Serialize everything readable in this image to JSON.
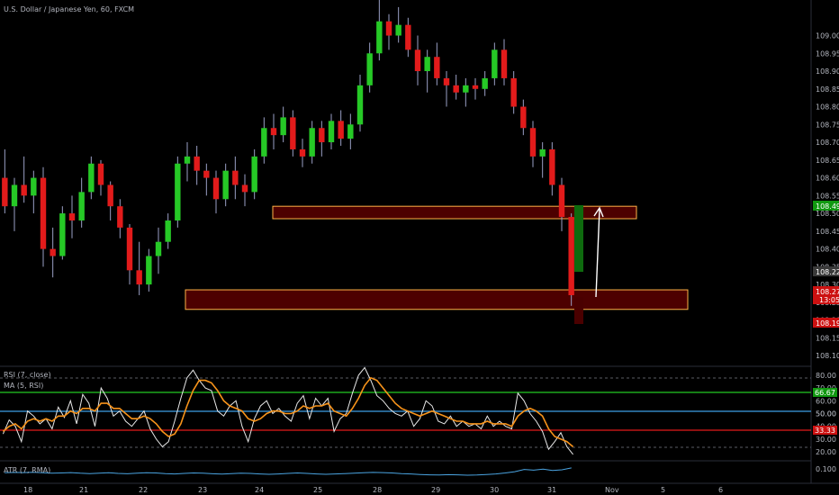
{
  "header": {
    "symbol_title": "U.S. Dollar / Japanese Yen, 60, FXCM"
  },
  "rsi_panel": {
    "title": "RSI (7, close)",
    "ma_title": "MA (5, RSI)"
  },
  "atr_panel": {
    "title": "ATR (7, RMA)"
  },
  "colors": {
    "background": "#000000",
    "candle_up": "#26c926",
    "candle_down": "#e21b1b",
    "wick": "#9aa0c6",
    "zone_fill": "#5a0000",
    "zone_border": "#ffb347",
    "rsi_line": "#e8e8e8",
    "rsi_ma_line": "#f7931a",
    "level_high": "#22c922",
    "level_mid": "#3c9ee5",
    "level_low": "#e21b1b",
    "atr_line": "#4aa3e0",
    "target_arrow": "#ffffff",
    "tp_box": "#0e6b0e",
    "sl_box": "#4a0000"
  },
  "chart_data": [
    {
      "type": "candlestick",
      "title": "U.S. Dollar / Japanese Yen, 60, FXCM",
      "ylim": [
        108.07,
        109.1
      ],
      "y_ticks": [
        "109.00",
        "108.95",
        "108.90",
        "108.85",
        "108.80",
        "108.75",
        "108.70",
        "108.65",
        "108.60",
        "108.55",
        "108.50",
        "108.45",
        "108.40",
        "108.35",
        "108.30",
        "108.25",
        "108.20",
        "108.15",
        "108.10"
      ],
      "x_ticks": [
        "18",
        "21",
        "22",
        "23",
        "24",
        "25",
        "28",
        "29",
        "30",
        "31",
        "Nov",
        "5",
        "6"
      ],
      "price_tags": [
        {
          "text": "108.490",
          "kind": "target"
        },
        {
          "text": "108.220",
          "kind": "current"
        },
        {
          "text": "108.273",
          "kind": "last"
        },
        {
          "text": "13:05",
          "kind": "countdown"
        },
        {
          "text": "108.190",
          "kind": "stop"
        }
      ],
      "zones": [
        {
          "from": 108.485,
          "to": 108.52
        },
        {
          "from": 108.23,
          "to": 108.285
        }
      ],
      "series": [
        {
          "name": "",
          "values": [
            [
              108.6,
              108.68,
              108.5,
              108.52
            ],
            [
              108.52,
              108.6,
              108.45,
              108.58
            ],
            [
              108.58,
              108.66,
              108.53,
              108.55
            ],
            [
              108.55,
              108.62,
              108.5,
              108.6
            ],
            [
              108.6,
              108.63,
              108.35,
              108.4
            ],
            [
              108.4,
              108.46,
              108.32,
              108.38
            ],
            [
              108.38,
              108.52,
              108.37,
              108.5
            ],
            [
              108.5,
              108.55,
              108.43,
              108.48
            ],
            [
              108.48,
              108.6,
              108.46,
              108.56
            ],
            [
              108.56,
              108.66,
              108.54,
              108.64
            ],
            [
              108.64,
              108.65,
              108.55,
              108.58
            ],
            [
              108.58,
              108.59,
              108.48,
              108.52
            ],
            [
              108.52,
              108.54,
              108.43,
              108.46
            ],
            [
              108.46,
              108.47,
              108.3,
              108.34
            ],
            [
              108.34,
              108.42,
              108.27,
              108.3
            ],
            [
              108.3,
              108.4,
              108.28,
              108.38
            ],
            [
              108.38,
              108.46,
              108.33,
              108.42
            ],
            [
              108.42,
              108.5,
              108.4,
              108.48
            ],
            [
              108.48,
              108.66,
              108.46,
              108.64
            ],
            [
              108.64,
              108.7,
              108.59,
              108.66
            ],
            [
              108.66,
              108.69,
              108.58,
              108.62
            ],
            [
              108.62,
              108.64,
              108.55,
              108.6
            ],
            [
              108.6,
              108.62,
              108.5,
              108.54
            ],
            [
              108.54,
              108.64,
              108.52,
              108.62
            ],
            [
              108.62,
              108.66,
              108.54,
              108.58
            ],
            [
              108.58,
              108.61,
              108.52,
              108.56
            ],
            [
              108.56,
              108.68,
              108.54,
              108.66
            ],
            [
              108.66,
              108.77,
              108.64,
              108.74
            ],
            [
              108.74,
              108.78,
              108.68,
              108.72
            ],
            [
              108.72,
              108.8,
              108.7,
              108.77
            ],
            [
              108.77,
              108.79,
              108.66,
              108.68
            ],
            [
              108.68,
              108.71,
              108.63,
              108.66
            ],
            [
              108.66,
              108.76,
              108.64,
              108.74
            ],
            [
              108.74,
              108.76,
              108.66,
              108.7
            ],
            [
              108.7,
              108.78,
              108.68,
              108.76
            ],
            [
              108.76,
              108.79,
              108.69,
              108.71
            ],
            [
              108.71,
              108.78,
              108.68,
              108.75
            ],
            [
              108.75,
              108.89,
              108.73,
              108.86
            ],
            [
              108.86,
              108.98,
              108.84,
              108.95
            ],
            [
              108.95,
              109.1,
              108.93,
              109.04
            ],
            [
              109.04,
              109.06,
              108.96,
              109.0
            ],
            [
              109.0,
              109.08,
              108.98,
              109.03
            ],
            [
              109.03,
              109.05,
              108.94,
              108.96
            ],
            [
              108.96,
              109.0,
              108.86,
              108.9
            ],
            [
              108.9,
              108.96,
              108.84,
              108.94
            ],
            [
              108.94,
              108.98,
              108.86,
              108.88
            ],
            [
              108.88,
              108.9,
              108.8,
              108.86
            ],
            [
              108.86,
              108.89,
              108.82,
              108.84
            ],
            [
              108.84,
              108.88,
              108.8,
              108.86
            ],
            [
              108.86,
              108.88,
              108.82,
              108.85
            ],
            [
              108.85,
              108.9,
              108.83,
              108.88
            ],
            [
              108.88,
              108.98,
              108.86,
              108.96
            ],
            [
              108.96,
              108.99,
              108.86,
              108.88
            ],
            [
              108.88,
              108.9,
              108.78,
              108.8
            ],
            [
              108.8,
              108.82,
              108.72,
              108.74
            ],
            [
              108.74,
              108.76,
              108.63,
              108.66
            ],
            [
              108.66,
              108.7,
              108.6,
              108.68
            ],
            [
              108.68,
              108.7,
              108.55,
              108.58
            ],
            [
              108.58,
              108.6,
              108.45,
              108.49
            ],
            [
              108.49,
              108.5,
              108.24,
              108.27
            ]
          ]
        }
      ]
    },
    {
      "type": "line",
      "title": "RSI (7, close)",
      "ylim": [
        13,
        87
      ],
      "y_ticks": [
        "80.00",
        "70.00",
        "60.00",
        "50.00",
        "40.00",
        "30.00",
        "20.00"
      ],
      "level_labels": [
        "66.67",
        "50.00",
        "33.33"
      ],
      "levels": [
        66.67,
        50,
        33.33
      ],
      "series": [
        {
          "name": "",
          "values": [
            34,
            45,
            40,
            28,
            52,
            48,
            42,
            46,
            38,
            55,
            47,
            60,
            42,
            65,
            58,
            40,
            70,
            62,
            48,
            52,
            44,
            40,
            46,
            52,
            38,
            30,
            24,
            28,
            44,
            62,
            78,
            84,
            76,
            70,
            68,
            52,
            48,
            56,
            60,
            40,
            28,
            46,
            56,
            60,
            50,
            54,
            48,
            44,
            58,
            64,
            46,
            62,
            56,
            62,
            36,
            46,
            50,
            66,
            80,
            86,
            76,
            64,
            60,
            54,
            50,
            48,
            52,
            40,
            46,
            60,
            56,
            44,
            42,
            48,
            40,
            44,
            40,
            42,
            38,
            48,
            40,
            44,
            40,
            38,
            66,
            60,
            50,
            44,
            36,
            22,
            28,
            35,
            24,
            18
          ]
        },
        {
          "name": "",
          "values": [
            36,
            40,
            42,
            38,
            44,
            46,
            44,
            46,
            44,
            48,
            48,
            52,
            50,
            54,
            54,
            52,
            58,
            58,
            54,
            54,
            50,
            46,
            46,
            48,
            46,
            42,
            36,
            32,
            34,
            42,
            56,
            68,
            76,
            76,
            74,
            68,
            60,
            56,
            54,
            52,
            46,
            44,
            46,
            50,
            52,
            52,
            50,
            50,
            52,
            56,
            54,
            56,
            56,
            58,
            52,
            50,
            48,
            54,
            62,
            72,
            78,
            76,
            70,
            64,
            58,
            54,
            52,
            50,
            48,
            50,
            52,
            50,
            48,
            46,
            44,
            44,
            42,
            42,
            42,
            44,
            42,
            42,
            42,
            40,
            48,
            52,
            54,
            52,
            48,
            38,
            32,
            30,
            28,
            24
          ]
        }
      ]
    },
    {
      "type": "line",
      "title": "ATR (7, RMA)",
      "ylim": [
        0.05,
        0.17
      ],
      "y_ticks": [
        "0.100"
      ],
      "series": [
        {
          "name": "",
          "values": [
            0.106,
            0.108,
            0.107,
            0.109,
            0.106,
            0.104,
            0.105,
            0.107,
            0.104,
            0.102,
            0.104,
            0.106,
            0.103,
            0.101,
            0.104,
            0.106,
            0.105,
            0.102,
            0.1,
            0.103,
            0.105,
            0.104,
            0.101,
            0.099,
            0.102,
            0.104,
            0.103,
            0.1,
            0.098,
            0.1,
            0.103,
            0.105,
            0.103,
            0.1,
            0.098,
            0.1,
            0.102,
            0.104,
            0.106,
            0.108,
            0.107,
            0.105,
            0.102,
            0.1,
            0.097,
            0.095,
            0.094,
            0.096,
            0.095,
            0.093,
            0.094,
            0.097,
            0.1,
            0.105,
            0.112,
            0.124,
            0.12,
            0.126,
            0.118,
            0.122,
            0.132
          ]
        }
      ]
    }
  ]
}
